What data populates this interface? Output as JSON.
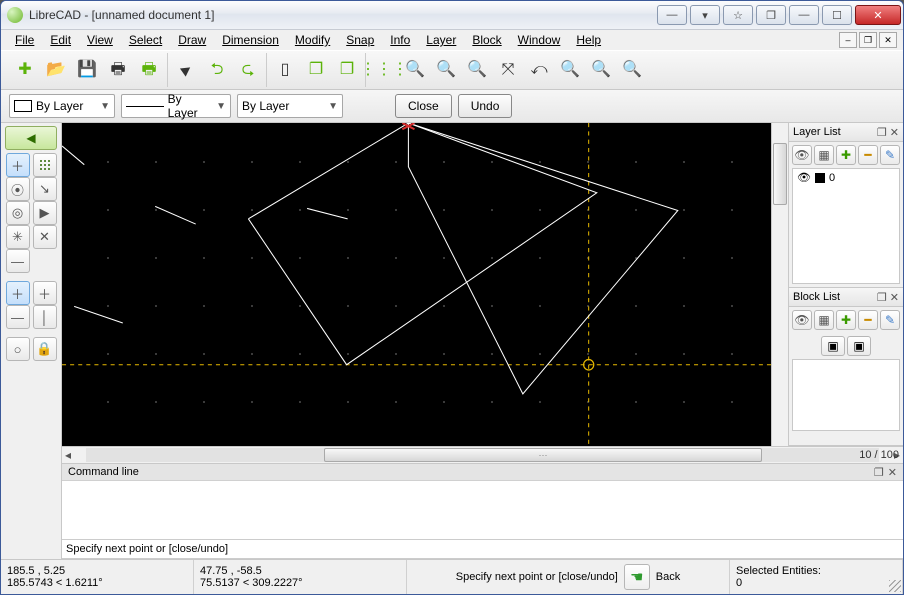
{
  "title": "LibreCAD - [unnamed document 1]",
  "menus": [
    "File",
    "Edit",
    "View",
    "Select",
    "Draw",
    "Dimension",
    "Modify",
    "Snap",
    "Info",
    "Layer",
    "Block",
    "Window",
    "Help"
  ],
  "toolbar_main": {
    "group_file": [
      {
        "name": "new-file-icon",
        "glyph": "✚",
        "cls": "g-green"
      },
      {
        "name": "open-file-icon",
        "glyph": "📂",
        "cls": "g-green"
      },
      {
        "name": "save-file-icon",
        "glyph": "💾",
        "cls": "g-green"
      },
      {
        "name": "print-icon",
        "glyph": "🖶",
        "cls": "g-dark"
      },
      {
        "name": "print-preview-icon",
        "glyph": "🖶",
        "cls": "g-green"
      }
    ],
    "group_edit": [
      {
        "name": "pick-arrow-icon",
        "glyph": "",
        "cls": "pick"
      },
      {
        "name": "undo-icon",
        "glyph": "⮌",
        "cls": "g-green"
      },
      {
        "name": "redo-icon",
        "glyph": "⮎",
        "cls": "g-green"
      }
    ],
    "group_clip": [
      {
        "name": "cut-icon",
        "glyph": "▯",
        "cls": "g-dark"
      },
      {
        "name": "copy-icon",
        "glyph": "❐",
        "cls": "g-green"
      },
      {
        "name": "paste-icon",
        "glyph": "❐",
        "cls": "g-green"
      }
    ],
    "group_view": [
      {
        "name": "toggle-grid-icon",
        "glyph": "⋮⋮⋮",
        "cls": "g-green"
      },
      {
        "name": "zoom-redraw-icon",
        "glyph": "🔍",
        "cls": "g-dark"
      },
      {
        "name": "zoom-in-icon",
        "glyph": "🔍",
        "cls": "g-dark"
      },
      {
        "name": "zoom-out-icon",
        "glyph": "🔍",
        "cls": "g-dark"
      },
      {
        "name": "zoom-auto-icon",
        "glyph": "⤧",
        "cls": "g-dark"
      },
      {
        "name": "zoom-prev-icon",
        "glyph": "⤺",
        "cls": "g-dark"
      },
      {
        "name": "zoom-window-icon",
        "glyph": "🔍",
        "cls": "g-dark"
      },
      {
        "name": "zoom-pan-icon",
        "glyph": "🔍",
        "cls": "g-green"
      },
      {
        "name": "zoom-extents-icon",
        "glyph": "🔍",
        "cls": "g-dark"
      }
    ]
  },
  "bylayer": {
    "color": "By Layer",
    "linetype": "By Layer",
    "lineweight": "By Layer"
  },
  "toolbar2_buttons": {
    "close": "Close",
    "undo": "Undo"
  },
  "left_tools_pairs": [
    [
      "lt-crosshair",
      "lt-griddots"
    ],
    [
      "lt-snap-endpoint",
      "lt-snap-on-entity"
    ],
    [
      "lt-snap-center",
      "lt-snap-mid"
    ],
    [
      "lt-snap-dist",
      "lt-snap-inter"
    ],
    [
      "lt-snap-hline",
      ""
    ],
    [
      "",
      ""
    ],
    [
      "lt-restrict-none",
      "lt-restrict-ortho"
    ],
    [
      "lt-restrict-horiz",
      "lt-restrict-vert"
    ],
    [
      "",
      ""
    ],
    [
      "lt-relzero",
      "lt-lockrelzero"
    ]
  ],
  "zoom": "10 / 100",
  "layer_panel": {
    "title": "Layer List",
    "tools": [
      "eye-icon",
      "toggle-frozen-icon",
      "add-layer-icon",
      "remove-layer-icon",
      "edit-layer-icon"
    ],
    "rows": [
      {
        "name": "0"
      }
    ]
  },
  "block_panel": {
    "title": "Block List",
    "tools": [
      "eye-icon",
      "toggle-icon",
      "add-block-icon",
      "remove-block-icon",
      "edit-block-icon"
    ],
    "tools2": [
      "insert-block-icon",
      "create-block-icon"
    ]
  },
  "command_panel": {
    "title": "Command line",
    "prompt": "Specify next point or  [close/undo]"
  },
  "status": {
    "abs_xy": "185.5 , 5.25",
    "abs_polar": "185.5743 < 1.6211°",
    "rel_xy": "47.75 , -58.5",
    "rel_polar": "75.5137 < 309.2227°",
    "prompt": "Specify next point or [close/undo]",
    "back": "Back",
    "sel_label": "Selected Entities:",
    "sel_count": "0"
  },
  "chart_data": null
}
